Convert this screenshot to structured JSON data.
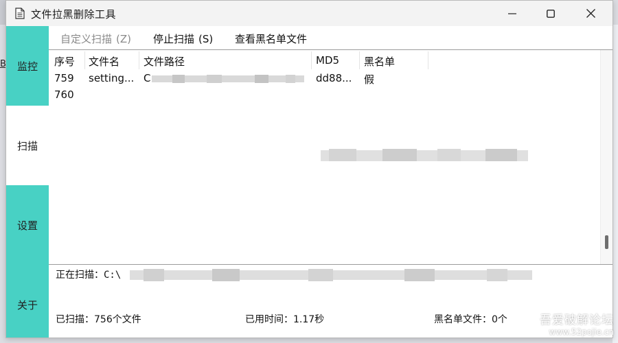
{
  "window": {
    "title": "文件拉黑删除工具",
    "icon": "document-icon"
  },
  "background": {
    "peek_text": "B"
  },
  "sidebar": {
    "items": [
      {
        "label": "监控",
        "active": false
      },
      {
        "label": "扫描",
        "active": true
      },
      {
        "label": "设置",
        "active": false
      },
      {
        "label": "关于",
        "active": false
      }
    ]
  },
  "toolbar": {
    "custom_scan": {
      "label": "自定义扫描",
      "hotkey": "(Z)",
      "enabled": false
    },
    "stop_scan": {
      "label": "停止扫描",
      "hotkey": "(S)",
      "enabled": true
    },
    "view_blacklist": {
      "label": "查看黑名单文件"
    }
  },
  "table": {
    "headers": [
      "序号",
      "文件名",
      "文件路径",
      "MD5",
      "黑名单"
    ],
    "rows": [
      {
        "index": "759",
        "filename": "setting...",
        "path": "C...",
        "md5": "dd88...",
        "blacklist": "假"
      },
      {
        "index": "760",
        "filename": "",
        "path": "",
        "md5": "",
        "blacklist": ""
      }
    ]
  },
  "status": {
    "current_label": "正在扫描：",
    "current_path": "C:\\",
    "scanned_label": "已扫描：",
    "scanned_value": "756个文件",
    "elapsed_label": "已用时间：",
    "elapsed_value": "1.17秒",
    "blacklist_label": "黑名单文件：",
    "blacklist_value": "0个"
  },
  "watermark": {
    "line1": "吾爱破解论坛",
    "line2": "www.52pojie.cn"
  },
  "colors": {
    "sidebar": "#48d1c4",
    "active_item": "#ffffff",
    "titlebar": "#f3f3f3"
  }
}
